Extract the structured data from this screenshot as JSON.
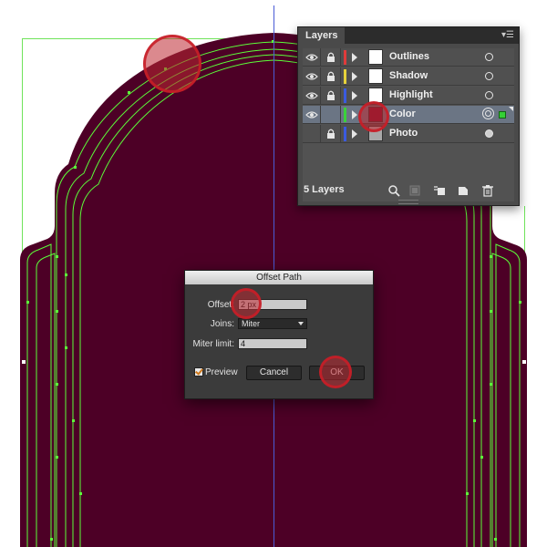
{
  "canvas": {
    "artwork_color": "#4d0026",
    "guide_color": "#4a5bd6",
    "path_color": "#5cff3a"
  },
  "layers_panel": {
    "tab_title": "Layers",
    "menu_icon": "panel-menu-icon",
    "layers": [
      {
        "name": "Outlines",
        "visible": true,
        "locked": true,
        "color": "#e03a3a",
        "target": "empty",
        "selected": false
      },
      {
        "name": "Shadow",
        "visible": true,
        "locked": true,
        "color": "#e6d23a",
        "target": "empty",
        "selected": false
      },
      {
        "name": "Highlight",
        "visible": true,
        "locked": true,
        "color": "#3a5ae0",
        "target": "empty",
        "selected": false
      },
      {
        "name": "Color",
        "visible": true,
        "locked": false,
        "color": "#3ad23a",
        "target": "double",
        "selected": true
      },
      {
        "name": "Photo",
        "visible": false,
        "locked": true,
        "color": "#3a5ae0",
        "target": "filled",
        "selected": false
      }
    ],
    "footer": {
      "count_label": "5 Layers",
      "icons": [
        "locate-object-icon",
        "make-clipping-mask-icon",
        "new-sublayer-icon",
        "new-layer-icon",
        "delete-icon"
      ]
    }
  },
  "offset_dialog": {
    "title": "Offset Path",
    "offset_label": "Offset:",
    "offset_value": "2 px",
    "joins_label": "Joins:",
    "joins_value": "Miter",
    "miter_label": "Miter limit:",
    "miter_value": "4",
    "preview_label": "Preview",
    "preview_checked": true,
    "cancel_label": "Cancel",
    "ok_label": "OK"
  }
}
